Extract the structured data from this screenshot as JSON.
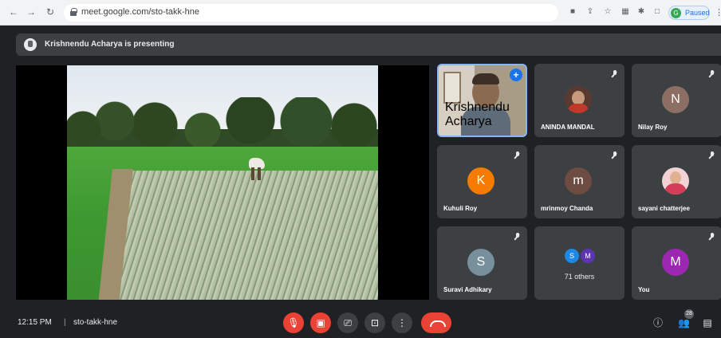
{
  "browser": {
    "url": "meet.google.com/sto-takk-hne",
    "profile_label": "Paused",
    "profile_initial": "G"
  },
  "banner": {
    "text": "Krishnendu Acharya is presenting"
  },
  "tiles": [
    {
      "name": "Krishnendu Acharya",
      "type": "video"
    },
    {
      "name": "ANINDA MANDAL",
      "type": "photo"
    },
    {
      "name": "Nilay Roy",
      "initial": "N",
      "color": "#8d6e63"
    },
    {
      "name": "Kuhuli Roy",
      "initial": "K",
      "color": "#f57c00"
    },
    {
      "name": "mrinmoy Chanda",
      "initial": "m",
      "color": "#6d4c41"
    },
    {
      "name": "sayani chatterjee",
      "type": "photo"
    },
    {
      "name": "Suravi Adhikary",
      "initial": "S",
      "color": "#78909c"
    },
    {
      "name": "71 others",
      "initials": [
        "S",
        "M"
      ],
      "colors": [
        "#1e88e5",
        "#5e35b1"
      ]
    },
    {
      "name": "You",
      "initial": "M",
      "color": "#9c27b0"
    }
  ],
  "bottom": {
    "time": "12:15 PM",
    "separator": "|",
    "meeting_code": "sto-takk-hne",
    "participants_count": "28"
  }
}
